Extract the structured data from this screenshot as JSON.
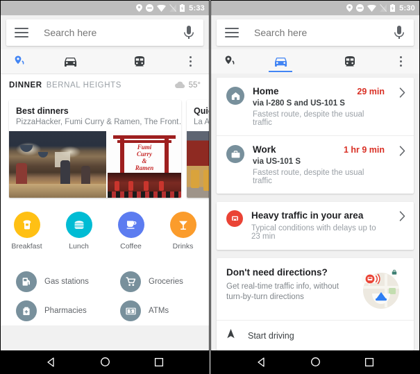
{
  "left": {
    "statusbar": {
      "time": "5:33",
      "icons": [
        "location-pin",
        "do-not-disturb",
        "wifi",
        "signal-off",
        "battery"
      ]
    },
    "search": {
      "placeholder": "Search here",
      "menu_icon": "hamburger-menu-icon",
      "mic_icon": "microphone-icon"
    },
    "tabs": [
      {
        "name": "explore",
        "icon": "place-pin-icon",
        "active": true
      },
      {
        "name": "driving",
        "icon": "car-icon",
        "active": false
      },
      {
        "name": "transit",
        "icon": "train-icon",
        "active": false
      },
      {
        "name": "overflow",
        "icon": "more-vertical-icon",
        "active": false
      }
    ],
    "dinner_header": {
      "label": "DINNER",
      "neighborhood": "BERNAL HEIGHTS",
      "weather_icon": "cloud-icon",
      "temperature": "55°"
    },
    "place_cards": [
      {
        "title": "Best dinners",
        "subtitle": "PizzaHacker, Fumi Curry & Ramen, The Front…",
        "photo_alt_1": "restaurant-interior-photo",
        "photo_alt_2": "fumi-curry-ramen-sign-photo"
      },
      {
        "title": "Quick",
        "subtitle": "La Alt",
        "photo_alt_1": "red-wall-wooden-chairs-photo"
      }
    ],
    "quick_actions": [
      {
        "label": "Breakfast",
        "icon": "bread-slice-icon",
        "color": "#FFC014"
      },
      {
        "label": "Lunch",
        "icon": "burger-icon",
        "color": "#00BCD4"
      },
      {
        "label": "Coffee",
        "icon": "coffee-cup-icon",
        "color": "#5C7CF0"
      },
      {
        "label": "Drinks",
        "icon": "cocktail-glass-icon",
        "color": "#FB9C2C"
      }
    ],
    "nearby": [
      {
        "label": "Gas stations",
        "icon": "gas-pump-icon"
      },
      {
        "label": "Groceries",
        "icon": "shopping-cart-icon"
      },
      {
        "label": "Pharmacies",
        "icon": "pharmacy-cross-icon"
      },
      {
        "label": "ATMs",
        "icon": "banknote-icon"
      }
    ],
    "navbar": {
      "back": "back-triangle-icon",
      "home": "home-circle-icon",
      "recents": "recents-square-icon"
    }
  },
  "right": {
    "statusbar": {
      "time": "5:30"
    },
    "search": {
      "placeholder": "Search here",
      "menu_icon": "hamburger-menu-icon",
      "mic_icon": "microphone-icon"
    },
    "tabs": [
      {
        "name": "explore",
        "icon": "place-pin-icon",
        "active": false
      },
      {
        "name": "driving",
        "icon": "car-icon",
        "active": true
      },
      {
        "name": "transit",
        "icon": "train-icon",
        "active": false
      },
      {
        "name": "overflow",
        "icon": "more-vertical-icon",
        "active": false
      }
    ],
    "routes": [
      {
        "name": "Home",
        "icon": "house-icon",
        "duration": "29 min",
        "via": "via I-280 S and US-101 S",
        "note": "Fastest route, despite the usual traffic",
        "chevron": "chevron-right-icon",
        "duration_color": "#D93025"
      },
      {
        "name": "Work",
        "icon": "briefcase-icon",
        "duration": "1 hr 9 min",
        "via": "via US-101 S",
        "note": "Fastest route, despite the usual traffic",
        "chevron": "chevron-right-icon",
        "duration_color": "#D93025"
      }
    ],
    "traffic_alert": {
      "icon": "traffic-alert-icon",
      "icon_color": "#EA4335",
      "title": "Heavy traffic in your area",
      "subtitle": "Typical conditions with delays up to 23 min",
      "chevron": "chevron-right-icon"
    },
    "promo": {
      "title": "Don't need directions?",
      "subtitle": "Get real-time traffic info, without turn-by-turn directions",
      "illustration": "driving-mode-map-illustration",
      "action_icon": "navigation-arrow-icon",
      "action_label": "Start driving"
    },
    "navbar": {
      "back": "back-triangle-icon",
      "home": "home-circle-icon",
      "recents": "recents-square-icon"
    }
  }
}
